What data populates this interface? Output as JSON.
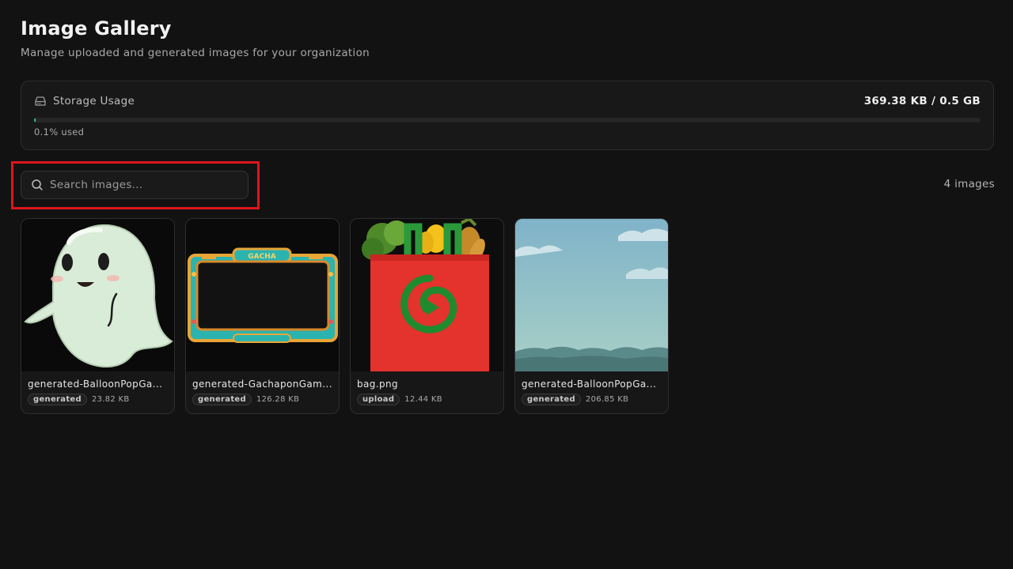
{
  "header": {
    "title": "Image Gallery",
    "subtitle": "Manage uploaded and generated images for your organization"
  },
  "storage": {
    "label": "Storage Usage",
    "value": "369.38 KB / 0.5 GB",
    "used_text": "0.1% used",
    "used_percent": 0.1,
    "icon": "hard-drive-icon",
    "accent_color": "#36c2a0"
  },
  "search": {
    "placeholder": "Search images...",
    "value": "",
    "icon": "search-icon"
  },
  "gallery": {
    "count_label": "4 images",
    "images": [
      {
        "name": "generated-BalloonPopGa...",
        "type": "generated",
        "size": "23.82 KB"
      },
      {
        "name": "generated-GachaponGam...",
        "type": "generated",
        "size": "126.28 KB"
      },
      {
        "name": "bag.png",
        "type": "upload",
        "size": "12.44 KB"
      },
      {
        "name": "generated-BalloonPopGa...",
        "type": "generated",
        "size": "206.85 KB"
      }
    ],
    "gacha_text": "GACHA"
  }
}
